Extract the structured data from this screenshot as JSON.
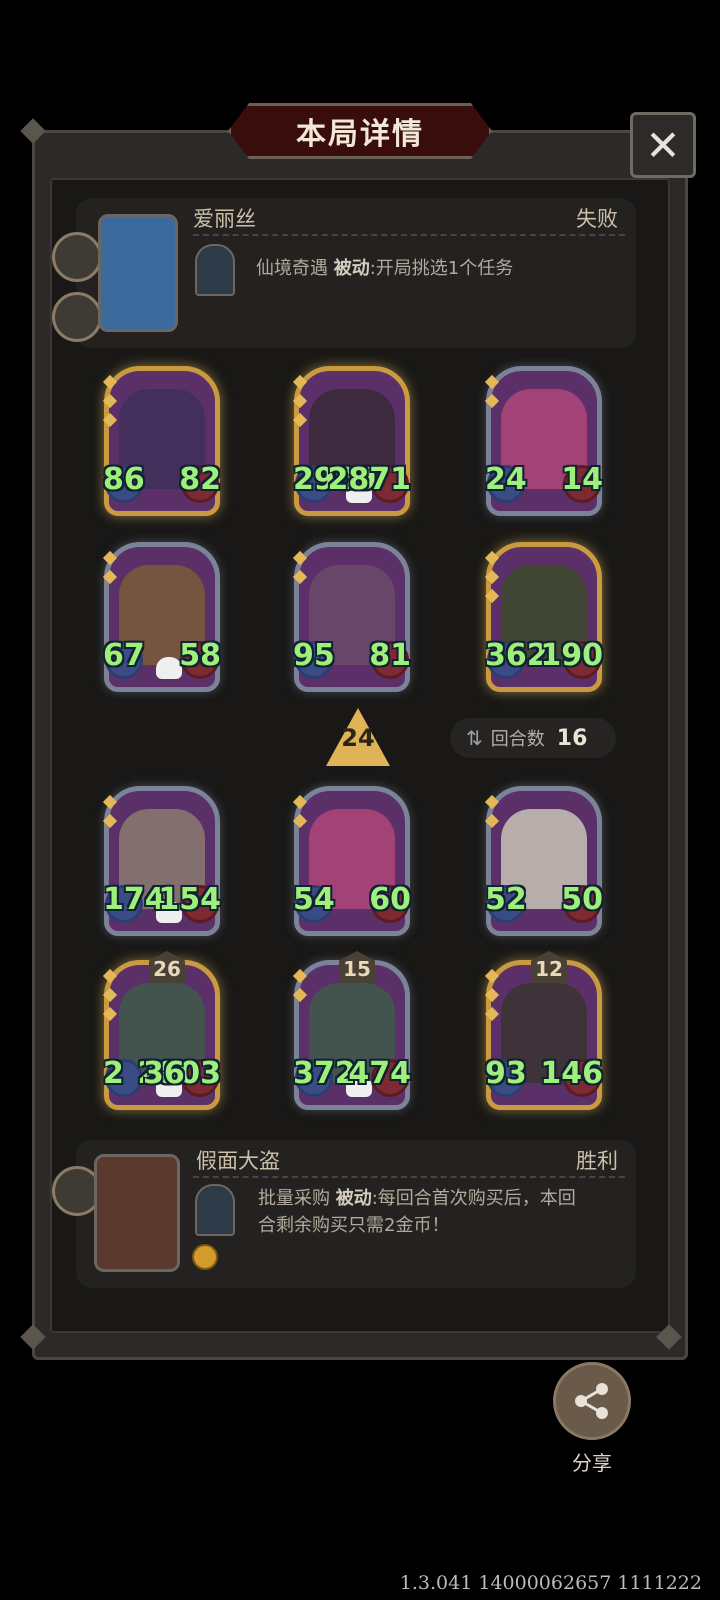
{
  "header": {
    "title": "本局详情"
  },
  "players": {
    "top": {
      "name": "爱丽丝",
      "result": "失败",
      "skill_name": "仙境奇遇",
      "skill_type": "被动",
      "skill_desc": ":开局挑选1个任务"
    },
    "bottom": {
      "name": "假面大盗",
      "result": "胜利",
      "skill_name": "批量采购",
      "skill_type": "被动",
      "skill_desc_1": ":每回合首次购买后，本回",
      "skill_desc_2": "合剩余购买只需2金币！"
    }
  },
  "tier_level": "24",
  "rounds": {
    "label": "回合数",
    "value": "16"
  },
  "cards_top": [
    {
      "atk": "86",
      "hp": "82",
      "skull": false,
      "golden": true,
      "art": "#3e2f5a"
    },
    {
      "atk": "2909",
      "hp": "2871",
      "skull": true,
      "golden": true,
      "art": "#3b2a3a"
    },
    {
      "atk": "24",
      "hp": "14",
      "skull": false,
      "golden": false,
      "art": "#b0457a"
    },
    {
      "atk": "67",
      "hp": "58",
      "skull": true,
      "golden": false,
      "art": "#7a5a3a"
    },
    {
      "atk": "95",
      "hp": "81",
      "skull": false,
      "golden": false,
      "art": "#6a4a6a"
    },
    {
      "atk": "362",
      "hp": "190",
      "skull": false,
      "golden": true,
      "art": "#3d4a2d"
    }
  ],
  "cards_bottom": [
    {
      "atk": "174",
      "hp": "154",
      "skull": true,
      "golden": false,
      "art": "#8a7a70",
      "level": ""
    },
    {
      "atk": "54",
      "hp": "60",
      "skull": false,
      "golden": false,
      "art": "#b0457a",
      "level": ""
    },
    {
      "atk": "52",
      "hp": "50",
      "skull": false,
      "golden": false,
      "art": "#c8c4b8",
      "level": ""
    },
    {
      "atk": "2",
      "hp": "2803",
      "skull": true,
      "golden": true,
      "art": "#3f5a4a",
      "level": "26",
      "extra": "36"
    },
    {
      "atk": "372",
      "hp": "474",
      "skull": true,
      "golden": false,
      "art": "#3f5a4a",
      "level": "15"
    },
    {
      "atk": "93",
      "hp": "146",
      "skull": false,
      "golden": true,
      "art": "#3a3430",
      "level": "12"
    }
  ],
  "share": {
    "label": "分享",
    "icon": "share-icon"
  },
  "version": "1.3.041 14000062657 1111222",
  "colors": {
    "stat_green": "#9ef07a",
    "gold_frame": "#c99a3f",
    "title_red": "#3a0d0d"
  }
}
